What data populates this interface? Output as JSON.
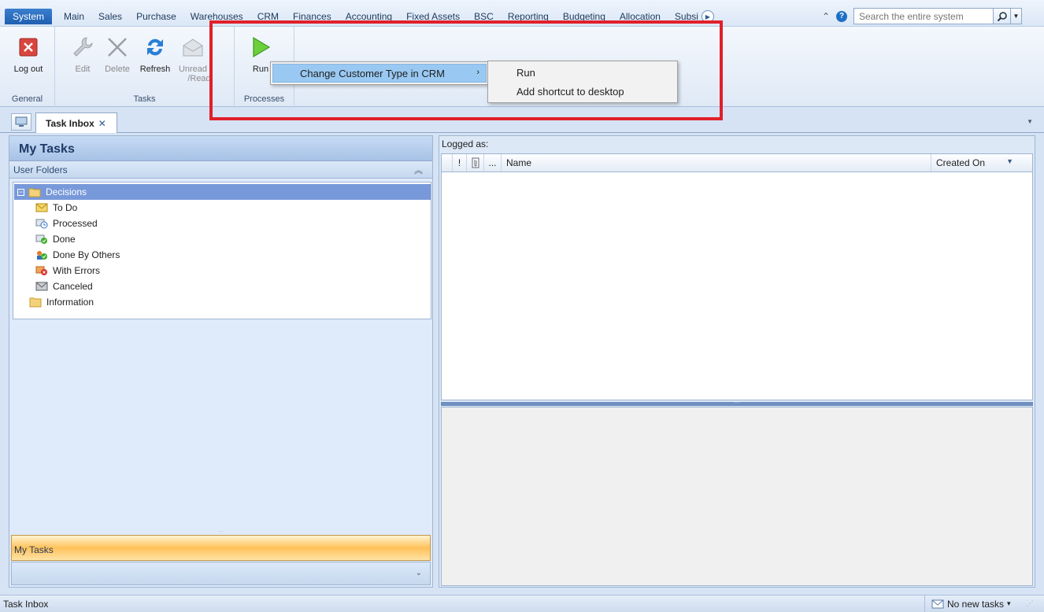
{
  "menubar": {
    "tabs": [
      "System",
      "Main",
      "Sales",
      "Purchase",
      "Warehouses",
      "CRM",
      "Finances",
      "Accounting",
      "Fixed Assets",
      "BSC",
      "Reporting",
      "Budgeting",
      "Allocation",
      "Subsi"
    ],
    "search_placeholder": "Search the entire system"
  },
  "ribbon": {
    "groups": {
      "general": "General",
      "tasks": "Tasks",
      "processes": "Processes"
    },
    "buttons": {
      "logout": "Log out",
      "edit": "Edit",
      "delete": "Delete",
      "refresh": "Refresh",
      "unread_line1": "Unread",
      "unread_line2": "/Read",
      "run": "Run"
    }
  },
  "context_menu": {
    "item": "Change Customer Type in CRM",
    "submenu": [
      "Run",
      "Add shortcut to desktop"
    ]
  },
  "doc_tab": {
    "label": "Task Inbox",
    "close": "✕"
  },
  "left_pane": {
    "title": "My Tasks",
    "section": "User Folders",
    "tree": {
      "decisions": "Decisions",
      "children": [
        "To Do",
        "Processed",
        "Done",
        "Done By Others",
        "With Errors",
        "Canceled"
      ],
      "information": "Information"
    },
    "nav_button": "My Tasks"
  },
  "right_pane": {
    "logged_as": "Logged as:",
    "columns": {
      "priority": "!",
      "more": "...",
      "name": "Name",
      "created_on": "Created On"
    }
  },
  "statusbar": {
    "left": "Task Inbox",
    "right": "No new tasks"
  },
  "colors": {
    "accent": "#1f5fb0",
    "highlight_border": "#e0202a",
    "menu_selection": "#99c9f2",
    "tree_selection": "#7899d9"
  }
}
